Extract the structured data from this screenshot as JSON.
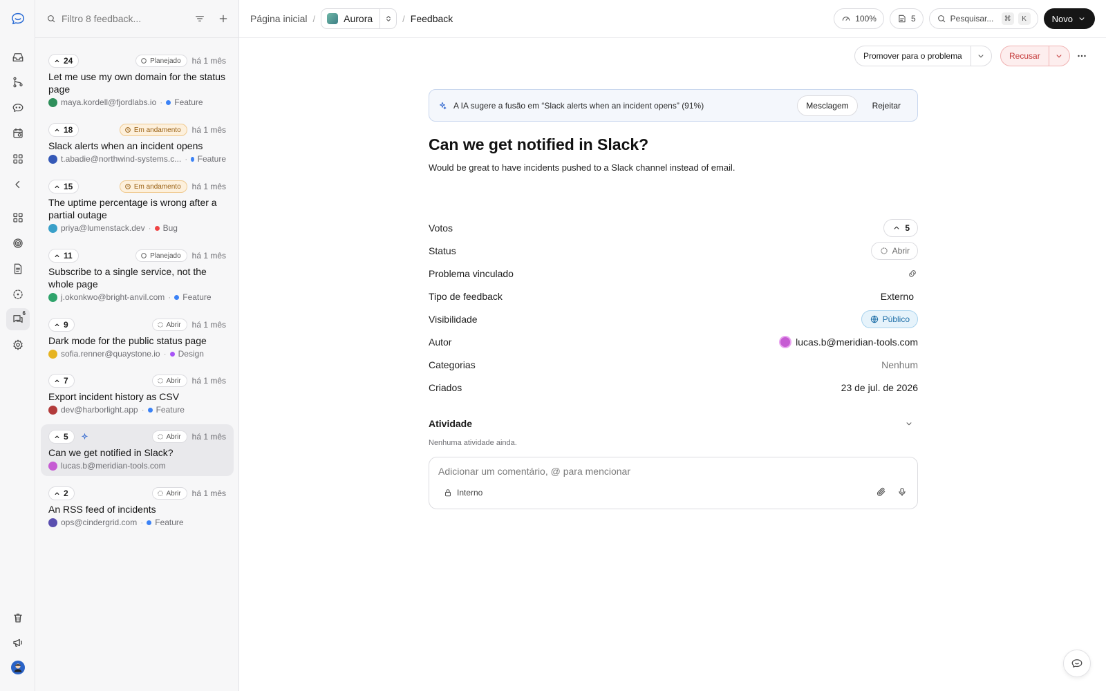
{
  "colors": {
    "accent_dark": "#161616",
    "danger": "#c53a3a",
    "progress": "#9a6114",
    "public": "#1e6fa8",
    "feature_tag": "#3b82f6",
    "bug_tag": "#ef4444",
    "design_tag": "#a855f7"
  },
  "rail": {
    "items": [
      "logo-icon",
      "inbox-icon",
      "git-branch-icon",
      "chat-bot-icon",
      "calendar-icon",
      "grid-icon",
      "collapse-icon",
      "apps-icon",
      "target-icon",
      "document-icon",
      "dashed-circle-icon",
      "feedback-icon",
      "settings-icon",
      "trash-icon",
      "megaphone-icon",
      "user-avatar"
    ],
    "feedback_badge": "6"
  },
  "list": {
    "search_placeholder": "Filtro 8 feedback...",
    "items": [
      {
        "votes": "24",
        "status": "Planejado",
        "status_kind": "plain",
        "time": "há 1 mês",
        "title": "Let me use my own domain for the status page",
        "email": "maya.kordell@fjordlabs.io",
        "tag": "Feature"
      },
      {
        "votes": "18",
        "status": "Em andamento",
        "status_kind": "progress",
        "time": "há 1 mês",
        "title": "Slack alerts when an incident opens",
        "email": "t.abadie@northwind-systems.c...",
        "tag": "Feature"
      },
      {
        "votes": "15",
        "status": "Em andamento",
        "status_kind": "progress",
        "time": "há 1 mês",
        "title": "The uptime percentage is wrong after a partial outage",
        "email": "priya@lumenstack.dev",
        "tag": "Bug"
      },
      {
        "votes": "11",
        "status": "Planejado",
        "status_kind": "plain",
        "time": "há 1 mês",
        "title": "Subscribe to a single service, not the whole page",
        "email": "j.okonkwo@bright-anvil.com",
        "tag": "Feature"
      },
      {
        "votes": "9",
        "status": "Abrir",
        "status_kind": "open",
        "time": "há 1 mês",
        "title": "Dark mode for the public status page",
        "email": "sofia.renner@quaystone.io",
        "tag": "Design"
      },
      {
        "votes": "7",
        "status": "Abrir",
        "status_kind": "open",
        "time": "há 1 mês",
        "title": "Export incident history as CSV",
        "email": "dev@harborlight.app",
        "tag": "Feature"
      },
      {
        "votes": "5",
        "status": "Abrir",
        "status_kind": "open",
        "time": "há 1 mês",
        "title": "Can we get notified in Slack?",
        "email": "lucas.b@meridian-tools.com",
        "tag": ""
      },
      {
        "votes": "2",
        "status": "Abrir",
        "status_kind": "open",
        "time": "há 1 mês",
        "title": "An RSS feed of incidents",
        "email": "ops@cindergrid.com",
        "tag": "Feature"
      }
    ]
  },
  "topbar": {
    "crumb_home": "Página inicial",
    "crumb_sep": "/",
    "project": "Aurora",
    "crumb_current": "Feedback",
    "zoom": "100%",
    "notes_count": "5",
    "search": "Pesquisar...",
    "kbd_cmd": "⌘",
    "kbd_k": "K",
    "new_label": "Novo"
  },
  "actions": {
    "promote": "Promover para o problema",
    "decline": "Recusar"
  },
  "ai_banner": {
    "text": "A IA sugere a fusão em “Slack alerts when an incident opens” (91%)",
    "merge": "Mesclagem",
    "reject": "Rejeitar"
  },
  "detail": {
    "title": "Can we get notified in Slack?",
    "description": "Would be great to have incidents pushed to a Slack channel instead of email.",
    "props": {
      "votes_label": "Votos",
      "votes_value": "5",
      "status_label": "Status",
      "status_value": "Abrir",
      "issue_label": "Problema vinculado",
      "type_label": "Tipo de feedback",
      "type_value": "Externo",
      "visibility_label": "Visibilidade",
      "visibility_value": "Público",
      "author_label": "Autor",
      "author_value": "lucas.b@meridian-tools.com",
      "categories_label": "Categorias",
      "categories_value": "Nenhum",
      "created_label": "Criados",
      "created_value": "23 de jul. de 2026"
    },
    "activity_title": "Atividade",
    "activity_empty": "Nenhuma atividade ainda.",
    "comment_placeholder": "Adicionar um comentário, @ para mencionar",
    "comment_visibility": "Interno"
  }
}
